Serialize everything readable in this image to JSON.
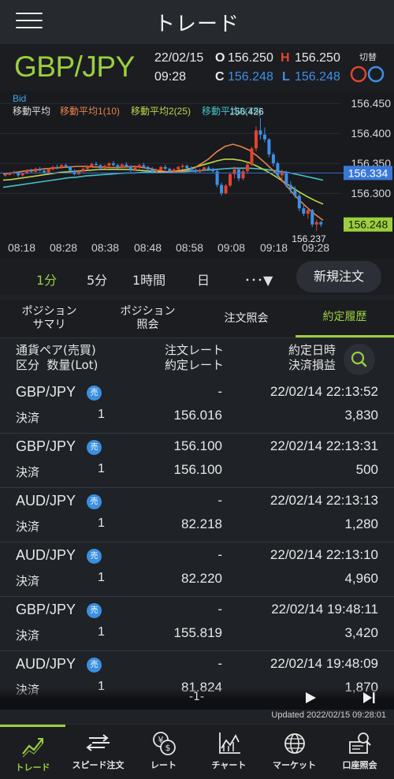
{
  "header": {
    "title": "トレード"
  },
  "quote": {
    "pair": "GBP/JPY",
    "date": "22/02/15",
    "time": "09:28",
    "o_label": "O",
    "o_value": "156.250",
    "h_label": "H",
    "h_value": "156.250",
    "c_label": "C",
    "c_value": "156.248",
    "l_label": "L",
    "l_value": "156.248",
    "switch_label": "切替"
  },
  "chart_labels": {
    "bid": "Bid",
    "ma": "移動平均",
    "ma1": "移動平均1(10)",
    "ma2": "移動平均2(25)",
    "ma3": "移動平均3(75)",
    "high_marker": "156.426",
    "low_marker": "156.237",
    "price_ma_tag": "156.334",
    "price_last_tag": "156.248",
    "price_ma_tag_value": 156.334,
    "price_last_tag_value": 156.248
  },
  "chart_data": {
    "type": "candlestick",
    "x_ticks": [
      "08:18",
      "08:28",
      "08:38",
      "08:48",
      "08:58",
      "09:08",
      "09:18",
      "09:28"
    ],
    "y_ticks": [
      "156.450",
      "156.400",
      "156.350",
      "156.300"
    ],
    "y_tick_values": [
      156.45,
      156.4,
      156.35,
      156.3
    ],
    "ylim": [
      156.22,
      156.47
    ],
    "candles": [
      [
        156.33,
        156.334,
        156.328,
        156.331
      ],
      [
        156.331,
        156.336,
        156.33,
        156.334
      ],
      [
        156.334,
        156.338,
        156.331,
        156.335
      ],
      [
        156.335,
        156.336,
        156.327,
        156.33
      ],
      [
        156.33,
        156.334,
        156.328,
        156.333
      ],
      [
        156.333,
        156.34,
        156.332,
        156.338
      ],
      [
        156.338,
        156.341,
        156.334,
        156.336
      ],
      [
        156.336,
        156.343,
        156.335,
        156.341
      ],
      [
        156.341,
        156.344,
        156.336,
        156.338
      ],
      [
        156.338,
        156.34,
        156.333,
        156.335
      ],
      [
        156.335,
        156.342,
        156.334,
        156.34
      ],
      [
        156.34,
        156.346,
        156.338,
        156.344
      ],
      [
        156.344,
        156.348,
        156.34,
        156.343
      ],
      [
        156.343,
        156.349,
        156.341,
        156.347
      ],
      [
        156.347,
        156.35,
        156.343,
        156.345
      ],
      [
        156.345,
        156.346,
        156.336,
        156.338
      ],
      [
        156.338,
        156.34,
        156.33,
        156.332
      ],
      [
        156.332,
        156.339,
        156.331,
        156.337
      ],
      [
        156.337,
        156.343,
        156.335,
        156.341
      ],
      [
        156.341,
        156.347,
        156.339,
        156.345
      ],
      [
        156.345,
        156.351,
        156.343,
        156.349
      ],
      [
        156.349,
        156.353,
        156.346,
        156.347
      ],
      [
        156.347,
        156.349,
        156.34,
        156.342
      ],
      [
        156.342,
        156.348,
        156.341,
        156.346
      ],
      [
        156.346,
        156.352,
        156.344,
        156.35
      ],
      [
        156.35,
        156.354,
        156.345,
        156.347
      ],
      [
        156.347,
        156.349,
        156.341,
        156.343
      ],
      [
        156.343,
        156.35,
        156.342,
        156.348
      ],
      [
        156.348,
        156.352,
        156.343,
        156.345
      ],
      [
        156.345,
        156.347,
        156.336,
        156.339
      ],
      [
        156.339,
        156.345,
        156.337,
        156.343
      ],
      [
        156.343,
        156.349,
        156.341,
        156.347
      ],
      [
        156.347,
        156.351,
        156.342,
        156.344
      ],
      [
        156.344,
        156.346,
        156.337,
        156.34
      ],
      [
        156.34,
        156.344,
        156.333,
        156.336
      ],
      [
        156.336,
        156.341,
        156.334,
        156.339
      ],
      [
        156.339,
        156.346,
        156.338,
        156.344
      ],
      [
        156.344,
        156.348,
        156.339,
        156.341
      ],
      [
        156.341,
        156.343,
        156.334,
        156.337
      ],
      [
        156.337,
        156.342,
        156.335,
        156.34
      ],
      [
        156.34,
        156.346,
        156.339,
        156.344
      ],
      [
        156.344,
        156.349,
        156.34,
        156.346
      ],
      [
        156.346,
        156.348,
        156.339,
        156.342
      ],
      [
        156.342,
        156.345,
        156.336,
        156.339
      ],
      [
        156.339,
        156.342,
        156.333,
        156.336
      ],
      [
        156.336,
        156.341,
        156.333,
        156.339
      ],
      [
        156.339,
        156.345,
        156.337,
        156.343
      ],
      [
        156.343,
        156.346,
        156.337,
        156.34
      ],
      [
        156.34,
        156.343,
        156.334,
        156.337
      ],
      [
        156.337,
        156.339,
        156.31,
        156.314
      ],
      [
        156.314,
        156.318,
        156.296,
        156.3
      ],
      [
        156.3,
        156.316,
        156.298,
        156.313
      ],
      [
        156.313,
        156.335,
        156.31,
        156.332
      ],
      [
        156.332,
        156.345,
        156.325,
        156.34
      ],
      [
        156.34,
        156.342,
        156.32,
        156.325
      ],
      [
        156.325,
        156.34,
        156.322,
        156.337
      ],
      [
        156.337,
        156.352,
        156.333,
        156.348
      ],
      [
        156.348,
        156.378,
        156.346,
        156.375
      ],
      [
        156.375,
        156.412,
        156.37,
        156.405
      ],
      [
        156.405,
        156.426,
        156.39,
        156.398
      ],
      [
        156.398,
        156.41,
        156.385,
        156.39
      ],
      [
        156.39,
        156.392,
        156.36,
        156.365
      ],
      [
        156.365,
        156.368,
        156.345,
        156.35
      ],
      [
        156.35,
        156.353,
        156.325,
        156.33
      ],
      [
        156.33,
        156.34,
        156.318,
        156.336
      ],
      [
        156.336,
        156.338,
        156.31,
        156.314
      ],
      [
        156.314,
        156.32,
        156.3,
        156.306
      ],
      [
        156.306,
        156.312,
        156.292,
        156.296
      ],
      [
        156.296,
        156.3,
        156.27,
        156.275
      ],
      [
        156.275,
        156.282,
        156.262,
        156.266
      ],
      [
        156.266,
        156.276,
        156.258,
        156.272
      ],
      [
        156.272,
        156.274,
        156.244,
        156.248
      ],
      [
        156.248,
        156.256,
        156.237,
        156.252
      ],
      [
        156.252,
        156.254,
        156.244,
        156.248
      ]
    ],
    "ma10": [
      156.332,
      156.334,
      156.336,
      156.338,
      156.339,
      156.341,
      156.342,
      156.343,
      156.344,
      156.345,
      156.345,
      156.344,
      156.344,
      156.343,
      156.343,
      156.344,
      156.345,
      156.343,
      156.341,
      156.338,
      156.336,
      156.336,
      156.337,
      156.34,
      156.348,
      156.357,
      156.369,
      156.378,
      156.382,
      156.378,
      156.372,
      156.362,
      156.35,
      156.337,
      156.322,
      156.305,
      156.29,
      156.277,
      156.265,
      156.255
    ],
    "ma25": [
      156.322,
      156.323,
      156.325,
      156.327,
      156.329,
      156.331,
      156.333,
      156.335,
      156.336,
      156.337,
      156.338,
      156.339,
      156.34,
      156.34,
      156.34,
      156.34,
      156.339,
      156.338,
      156.337,
      156.336,
      156.336,
      156.337,
      156.339,
      156.342,
      156.346,
      156.35,
      156.354,
      156.357,
      156.357,
      156.355,
      156.351,
      156.345,
      156.338,
      156.33,
      156.321,
      156.312,
      156.303,
      156.295,
      156.288,
      156.282
    ],
    "ma75": [
      156.31,
      156.312,
      156.314,
      156.316,
      156.318,
      156.32,
      156.322,
      156.324,
      156.326,
      156.327,
      156.329,
      156.33,
      156.331,
      156.332,
      156.333,
      156.334,
      156.334,
      156.335,
      156.335,
      156.335,
      156.335,
      156.336,
      156.336,
      156.337,
      156.338,
      156.339,
      156.34,
      156.341,
      156.342,
      156.342,
      156.342,
      156.341,
      156.34,
      156.338,
      156.336,
      156.334,
      156.331,
      156.328,
      156.325,
      156.322
    ]
  },
  "timeframes": [
    "1分",
    "5分",
    "1時間",
    "日",
    "･･･▼"
  ],
  "new_order_label": "新規注文",
  "tabs": [
    {
      "l1": "ポジション",
      "l2": "サマリ"
    },
    {
      "l1": "ポジション",
      "l2": "照会"
    },
    {
      "l1": "注文照会",
      "l2": ""
    },
    {
      "l1": "約定履歴",
      "l2": ""
    }
  ],
  "columns": {
    "c1a": "通貨ペア(売買)",
    "c1b": "区分  数量(Lot)",
    "c2a": "注文レート",
    "c2b": "約定レート",
    "c3a": "約定日時",
    "c3b": "決済損益"
  },
  "rows": [
    {
      "pair": "GBP/JPY",
      "side": "売",
      "kind": "決済",
      "qty": "1",
      "order_rate": "-",
      "exec_rate": "156.016",
      "datetime": "22/02/14 22:13:52",
      "pnl": "3,830"
    },
    {
      "pair": "GBP/JPY",
      "side": "売",
      "kind": "決済",
      "qty": "1",
      "order_rate": "156.100",
      "exec_rate": "156.100",
      "datetime": "22/02/14 22:13:31",
      "pnl": "500"
    },
    {
      "pair": "AUD/JPY",
      "side": "売",
      "kind": "決済",
      "qty": "1",
      "order_rate": "-",
      "exec_rate": "82.218",
      "datetime": "22/02/14 22:13:13",
      "pnl": "1,280"
    },
    {
      "pair": "AUD/JPY",
      "side": "売",
      "kind": "決済",
      "qty": "1",
      "order_rate": "-",
      "exec_rate": "82.220",
      "datetime": "22/02/14 22:13:10",
      "pnl": "4,960"
    },
    {
      "pair": "GBP/JPY",
      "side": "売",
      "kind": "決済",
      "qty": "1",
      "order_rate": "-",
      "exec_rate": "155.819",
      "datetime": "22/02/14 19:48:11",
      "pnl": "3,420"
    },
    {
      "pair": "AUD/JPY",
      "side": "売",
      "kind": "決済",
      "qty": "1",
      "order_rate": "-",
      "exec_rate": "81.824",
      "datetime": "22/02/14 19:48:09",
      "pnl": "1,870"
    }
  ],
  "pager": {
    "page": "-1-"
  },
  "updated": "Updated  2022/02/15 09:28:01",
  "bottom_nav": [
    "トレード",
    "スピード注文",
    "レート",
    "チャート",
    "マーケット",
    "口座照会"
  ],
  "colors": {
    "accent": "#9bcf3d",
    "bull": "#e2452f",
    "bear": "#3f8fe5",
    "ma1": "#e8834a",
    "ma2": "#b8d84a",
    "ma3": "#45c2c9"
  }
}
